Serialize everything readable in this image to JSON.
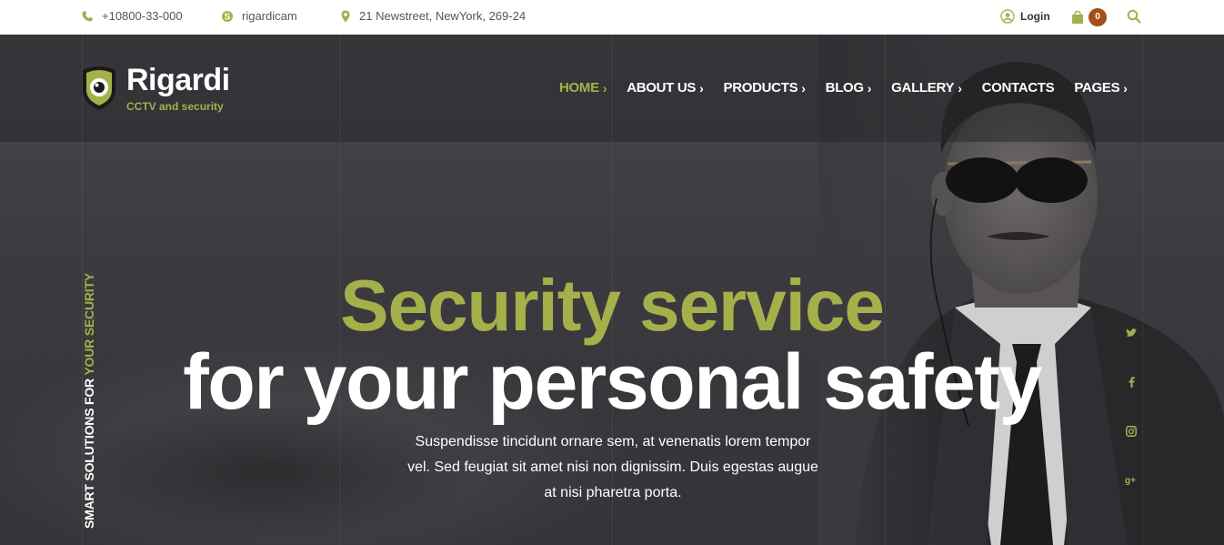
{
  "topbar": {
    "phone": "+10800-33-000",
    "skype": "rigardicam",
    "address": "21 Newstreet, NewYork, 269-24",
    "login_label": "Login",
    "cart_count": "0"
  },
  "brand": {
    "name": "Rigardi",
    "tagline": "CCTV and security"
  },
  "nav": {
    "items": [
      {
        "label": "HOME",
        "active": true,
        "chevron": "›"
      },
      {
        "label": "ABOUT US",
        "chevron": "›"
      },
      {
        "label": "PRODUCTS",
        "chevron": "›"
      },
      {
        "label": "BLOG",
        "chevron": "›"
      },
      {
        "label": "GALLERY",
        "chevron": "›"
      },
      {
        "label": "CONTACTS"
      },
      {
        "label": "PAGES",
        "chevron": "›"
      }
    ]
  },
  "hero": {
    "vertical_tagline_white": "SMART SOLUTIONS FOR ",
    "vertical_tagline_accent": "YOUR SECURITY",
    "headline_line1": "Security service",
    "headline_line2": "for your personal safety",
    "description": "Suspendisse tincidunt ornare sem, at venenatis lorem tempor vel. Sed feugiat sit amet nisi non dignissim. Duis egestas augue at nisi pharetra porta."
  },
  "social": {
    "twitter": "twitter-icon",
    "facebook": "facebook-icon",
    "instagram": "instagram-icon",
    "googleplus": "google-plus-icon"
  },
  "colors": {
    "accent": "#a6b04a",
    "badge": "#a64e19",
    "topbar_bg": "#ffffff",
    "hero_overlay": "#3a3a3e"
  }
}
